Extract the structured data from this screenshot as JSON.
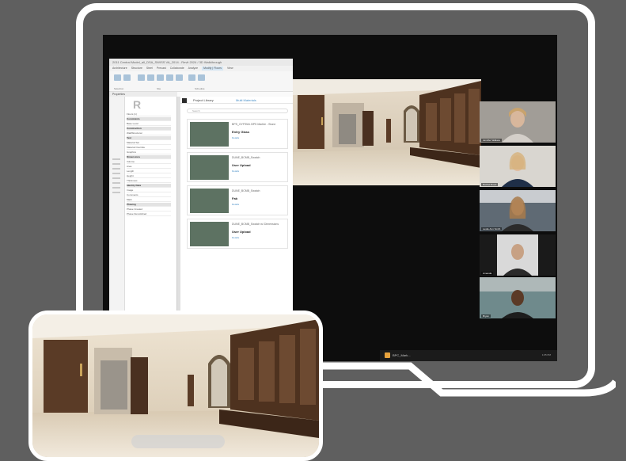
{
  "revit": {
    "title": "2011 Central Model_all_DSA_SWISS VA_2014 - Revit 2024 / 3D Walkthrough",
    "menu_items": [
      "Architecture",
      "Structure",
      "Steel",
      "Precast",
      "Collaborate",
      "Analyze",
      "Modify | Floors",
      "View"
    ],
    "active_menu": "Modify | Floors",
    "ribbon_groups": [
      "Selection",
      "Site",
      "Schedule"
    ],
    "properties_header": "Properties",
    "logo_letter": "R",
    "property_rows": [
      {
        "label": "Floors (1)",
        "header": false
      },
      {
        "label": "Constraints",
        "header": true
      },
      {
        "label": "Base Level",
        "header": false
      },
      {
        "label": "Construction",
        "header": true
      },
      {
        "label": "Wall/Structural",
        "header": false
      },
      {
        "label": "Text",
        "header": true
      },
      {
        "label": "Material Set",
        "header": false
      },
      {
        "label": "Material Override",
        "header": false
      },
      {
        "label": "Graphics",
        "header": false
      },
      {
        "label": "Dimensions",
        "header": true
      },
      {
        "label": "Volume",
        "header": false
      },
      {
        "label": "Area",
        "header": false
      },
      {
        "label": "Length",
        "header": false
      },
      {
        "label": "Height",
        "header": false
      },
      {
        "label": "Thickness",
        "header": false
      },
      {
        "label": "Identity Data",
        "header": true
      },
      {
        "label": "Image",
        "header": false
      },
      {
        "label": "Comments",
        "header": false
      },
      {
        "label": "Mark",
        "header": false
      },
      {
        "label": "Phasing",
        "header": true
      },
      {
        "label": "Phase Created",
        "header": false
      },
      {
        "label": "Phase Demolished",
        "header": false
      }
    ]
  },
  "library": {
    "tab_project": "Project Library",
    "tab_other": "Multi Materials",
    "search_placeholder": "Search",
    "items": [
      {
        "name": "BPS_GYP3WL BPS Marble - Stone",
        "subtitle": "Entry Glass",
        "link": "Details"
      },
      {
        "name": "DUNE_BCMB_Swatch",
        "subtitle": "User Upload",
        "link": "Details"
      },
      {
        "name": "DUNE_BCMB_Swatch",
        "subtitle": "Fab",
        "link": "Details"
      },
      {
        "name": "DUNE_BCMB_Swatch w/ Dimensions",
        "subtitle": "User Upload",
        "link": "Details"
      }
    ]
  },
  "participants": [
    {
      "name": "Jennifer Wallace"
    },
    {
      "name": "Rachel Reed"
    },
    {
      "name": "Leslie Ann Smith"
    },
    {
      "name": "Amanda"
    },
    {
      "name": "Bryan"
    }
  ],
  "taskbar": {
    "app_label": "BPC_Mark...",
    "time": "1:05 PM"
  },
  "colors": {
    "background": "#5f5f5f",
    "frame": "#ffffff",
    "wood_panel": "#5a3b26",
    "marble_wall": "#d9cbb5"
  }
}
